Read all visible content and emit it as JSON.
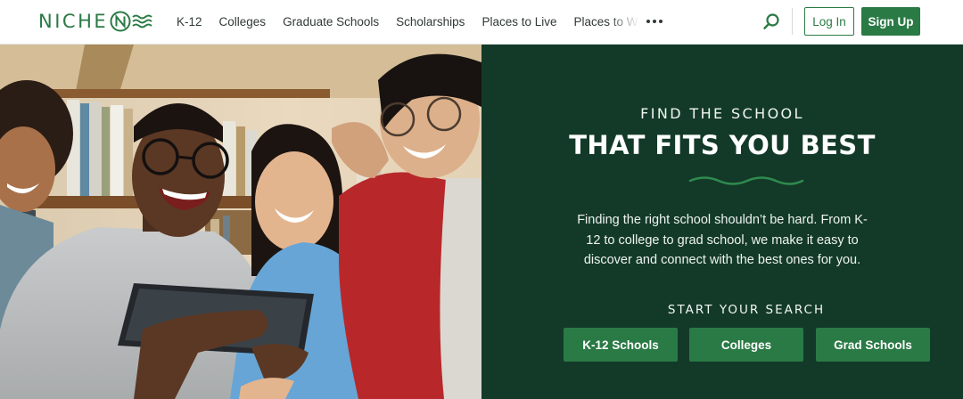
{
  "brand": {
    "name": "NICHE",
    "color": "#2a7a45",
    "dark_color": "#133a28"
  },
  "nav": {
    "items": [
      "K-12",
      "Colleges",
      "Graduate Schools",
      "Scholarships",
      "Places to Live"
    ],
    "truncated_item": "Places to Work",
    "more_icon": "more-horizontal-icon"
  },
  "header_actions": {
    "search_icon": "search-icon",
    "login_label": "Log In",
    "signup_label": "Sign Up"
  },
  "hero": {
    "eyebrow": "FIND THE SCHOOL",
    "headline": "THAT FITS YOU BEST",
    "description": "Finding the right school shouldn’t be hard. From K-12 to college to grad school, we make it easy to discover and connect with the best ones for you.",
    "search_title": "START YOUR SEARCH",
    "buttons": [
      "K-12 Schools",
      "Colleges",
      "Grad Schools"
    ]
  }
}
